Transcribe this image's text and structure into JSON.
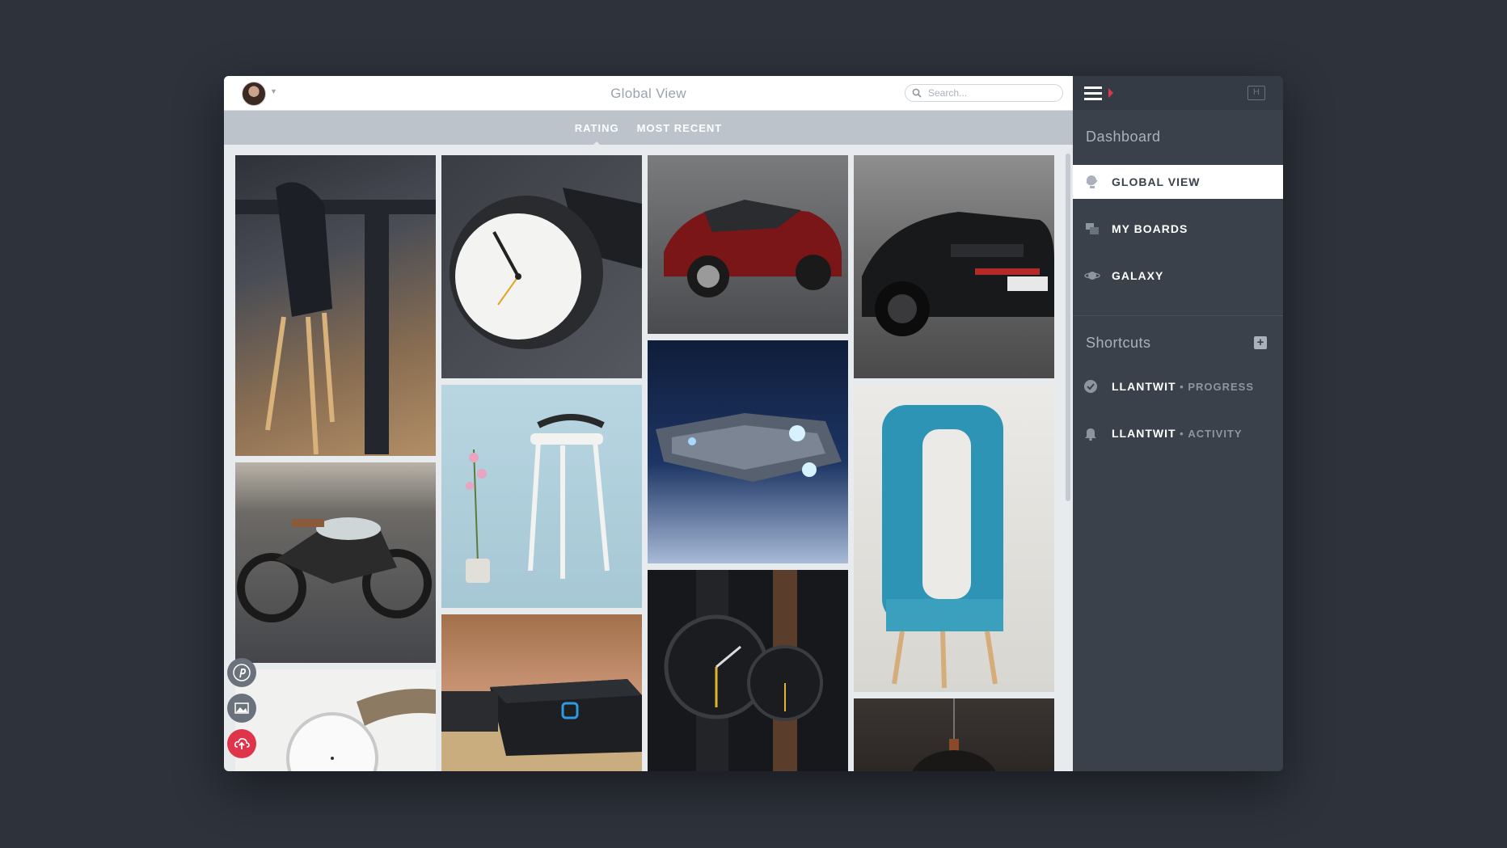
{
  "header": {
    "title": "Global View",
    "search_placeholder": "Search..."
  },
  "tabs": [
    {
      "label": "RATING",
      "active": true
    },
    {
      "label": "MOST RECENT",
      "active": false
    }
  ],
  "grid": {
    "images": [
      "black-chair-at-table-photo",
      "white-watch-closeup-photo",
      "red-sedan-photo",
      "black-sports-car-photo",
      "cafe-racer-motorcycle-photo",
      "white-chair-with-orchid-photo",
      "spaceship-in-space-photo",
      "blue-frame-chair-photo",
      "white-leather-watch-photo",
      "black-device-box-photo",
      "black-watches-pair-photo",
      "pendant-lamp-photo"
    ]
  },
  "floating_actions": [
    "pinterest-icon",
    "image-icon",
    "upload-icon"
  ],
  "sidebar": {
    "dashboard_title": "Dashboard",
    "nav_items": [
      {
        "label": "GLOBAL VIEW",
        "icon": "globe-icon",
        "active": true
      },
      {
        "label": "MY BOARDS",
        "icon": "boards-icon",
        "active": false
      },
      {
        "label": "GALAXY",
        "icon": "planet-icon",
        "active": false
      }
    ],
    "shortcuts_title": "Shortcuts",
    "shortcuts": [
      {
        "name": "LLANTWIT",
        "separator": " • ",
        "sub": "PROGRESS",
        "icon": "check-circle-icon"
      },
      {
        "name": "LLANTWIT",
        "separator": " • ",
        "sub": "ACTIVITY",
        "icon": "bell-icon"
      }
    ]
  },
  "colors": {
    "background": "#2d323b",
    "sidebar": "#3a414b",
    "accent": "#e0344a",
    "tabs_bar": "#bcc3ca"
  }
}
